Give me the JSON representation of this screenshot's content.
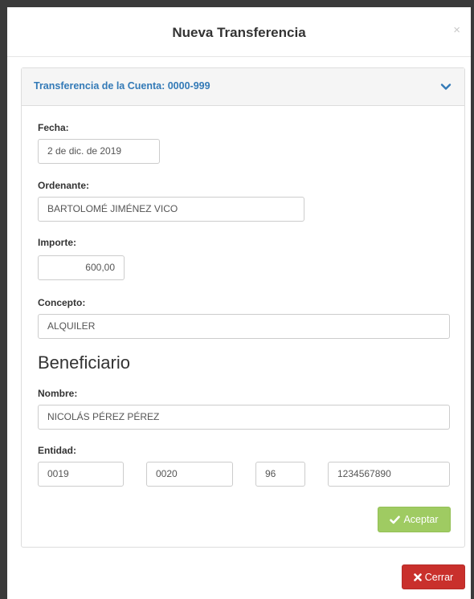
{
  "modal": {
    "title": "Nueva Transferencia",
    "close_glyph": "×"
  },
  "panel": {
    "heading": "Transferencia de la Cuenta: 0000-999",
    "toggle_icon": "chevron-down-icon"
  },
  "form": {
    "fecha": {
      "label": "Fecha:",
      "value": "2 de dic. de 2019"
    },
    "ordenante": {
      "label": "Ordenante:",
      "value": "BARTOLOMÉ JIMÉNEZ VICO"
    },
    "importe": {
      "label": "Importe:",
      "value": "600,00"
    },
    "concepto": {
      "label": "Concepto:",
      "value": "ALQUILER"
    }
  },
  "beneficiario": {
    "heading": "Beneficiario",
    "nombre": {
      "label": "Nombre:",
      "value": "NICOLÁS PÉREZ PÉREZ"
    },
    "entidad": {
      "label": "Entidad:",
      "values": [
        "0019",
        "0020",
        "96",
        "1234567890"
      ]
    }
  },
  "buttons": {
    "accept_label": "Aceptar",
    "accept_icon": "check-icon",
    "close_label": "Cerrar",
    "close_icon": "times-icon"
  },
  "colors": {
    "accent_blue": "#337ab7",
    "accept_green": "#9fcb62",
    "close_red": "#c9302c"
  }
}
